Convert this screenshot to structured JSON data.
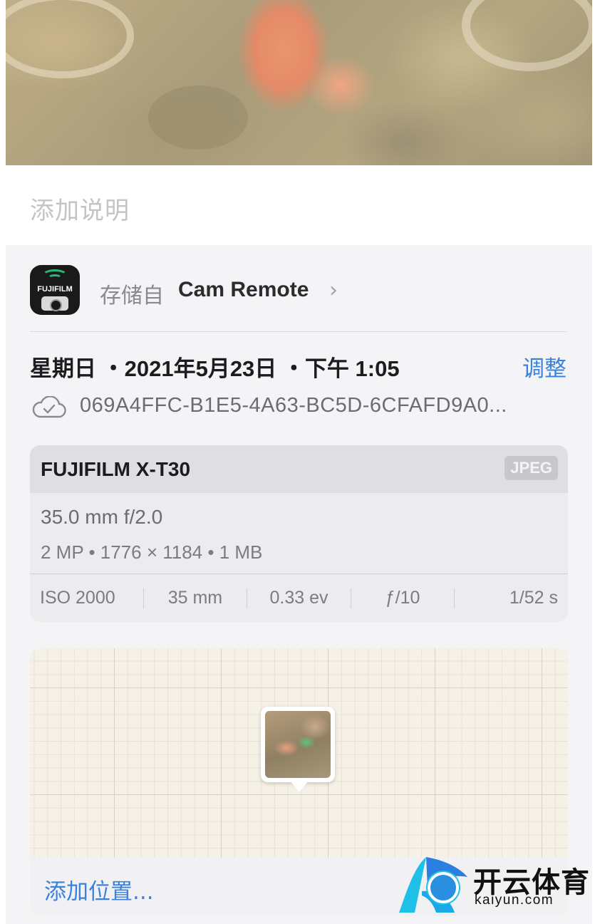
{
  "caption": {
    "placeholder": "添加说明"
  },
  "source": {
    "prefix": "存储自",
    "app_name": "Cam Remote",
    "chevron": "›",
    "icon": "fujifilm-cam-remote-app-icon",
    "icon_text": "FUJIFILM"
  },
  "meta": {
    "datetime": "星期日 ・2021年5月23日 ・下午 1:05",
    "adjust_label": "调整",
    "file_id": "069A4FFC-B1E5-4A63-BC5D-6CFAFD9A0...",
    "cloud_icon": "icloud-check-icon"
  },
  "exif": {
    "camera_model": "FUJIFILM X-T30",
    "format": "JPEG",
    "lens": "35.0 mm f/2.0",
    "specs": "2 MP  •  1776 × 1184  •  1 MB",
    "stats": [
      "ISO 2000",
      "35 mm",
      "0.33 ev",
      "ƒ/10",
      "1/52 s"
    ]
  },
  "map": {
    "add_location_label": "添加位置..."
  },
  "watermark": {
    "brand_cn": "开云体育",
    "brand_en": "kaiyun.com"
  },
  "colors": {
    "accent": "#3a82e0",
    "panel_bg": "#f4f4f6",
    "app_icon_bg": "#1a1a1a",
    "wifi_green": "#2bb673"
  }
}
